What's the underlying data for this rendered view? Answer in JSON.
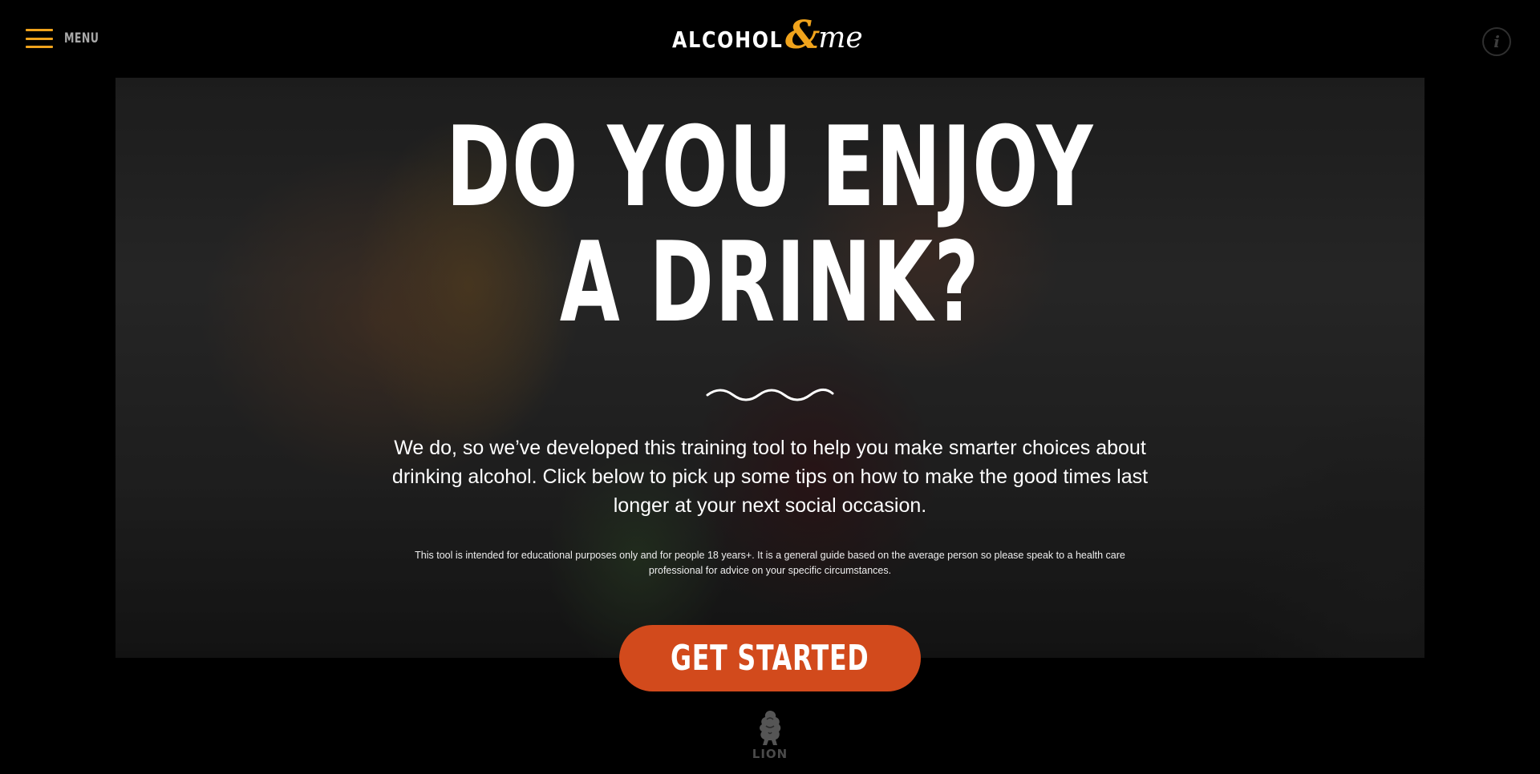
{
  "header": {
    "menu_label": "MENU",
    "logo": {
      "word": "ALCOHOL",
      "amp": "&",
      "me": "me"
    },
    "info_label": "i"
  },
  "hero": {
    "headline_line1": "DO YOU ENJOY",
    "headline_line2": "A DRINK?",
    "intro": "We do, so we’ve developed this training tool to help you make smarter choices about drinking alcohol. Click below to pick up some tips on how to make the good times last longer at your next social occasion.",
    "disclaimer": "This tool is intended for educational purposes only and for people 18 years+. It is a general guide based on the average person so please speak to a health care professional for advice on your specific circumstances."
  },
  "cta": {
    "label": "GET STARTED"
  },
  "footer": {
    "brand": "LION"
  },
  "colors": {
    "accent": "#f0a31c",
    "cta": "#d24a1c",
    "background": "#000000"
  },
  "icons": [
    "hamburger-icon",
    "info-icon",
    "wave-divider",
    "lion-logo"
  ]
}
